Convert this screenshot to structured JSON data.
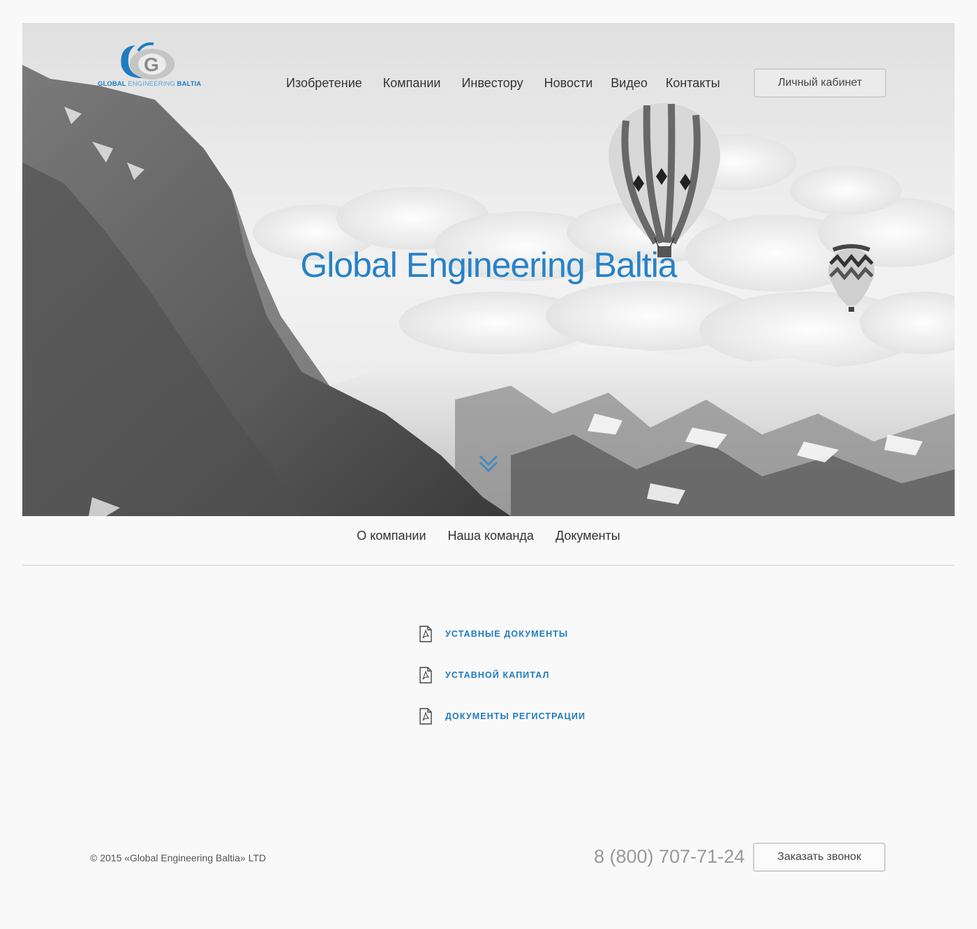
{
  "header": {
    "logo": {
      "text_global": "GLOBAL",
      "text_engineering": "ENGINEERING",
      "text_baltia": "BALTIA",
      "letter": "G"
    },
    "nav": [
      {
        "label": "Изобретение"
      },
      {
        "label": "Компании"
      },
      {
        "label": "Инвестору"
      },
      {
        "label": "Новости"
      },
      {
        "label": "Видео"
      },
      {
        "label": "Контакты"
      }
    ],
    "cabinet_button": "Личный кабинет"
  },
  "hero": {
    "title": "Global Engineering Baltia",
    "scroll_icon": "double-chevron-down-icon"
  },
  "subnav": [
    {
      "label": "О компании"
    },
    {
      "label": "Наша команда"
    },
    {
      "label": "Документы"
    }
  ],
  "documents": [
    {
      "icon": "pdf-icon",
      "label": "Уставные документы"
    },
    {
      "icon": "pdf-icon",
      "label": "Уставной капитал"
    },
    {
      "icon": "pdf-icon",
      "label": "Документы регистрации"
    }
  ],
  "footer": {
    "copyright": "© 2015 «Global Engineering Baltia» LTD",
    "phone": "8 (800) 707-71-24",
    "callback_button": "Заказать звонок"
  },
  "colors": {
    "accent": "#2782c8",
    "link": "#1f7bbf",
    "background": "#f9f9f9"
  }
}
